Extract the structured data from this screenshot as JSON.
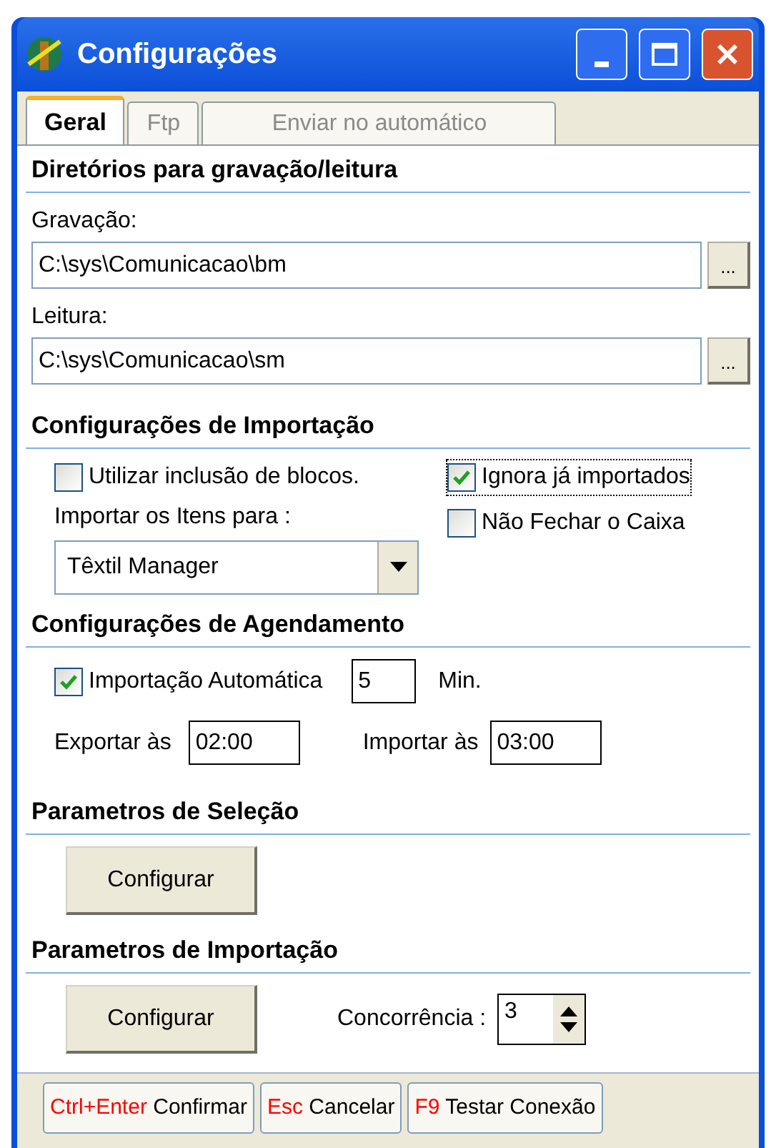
{
  "window": {
    "title": "Configurações"
  },
  "tabs": [
    {
      "label": "Geral",
      "selected": true
    },
    {
      "label": "Ftp",
      "selected": false
    },
    {
      "label": "Enviar no automático",
      "selected": false
    }
  ],
  "directories": {
    "heading": "Diretórios para gravação/leitura",
    "fields": [
      {
        "label": "Gravação:",
        "value": "C:\\sys\\Comunicacao\\bm",
        "button": "..."
      },
      {
        "label": "Leitura:",
        "value": "C:\\sys\\Comunicacao\\sm",
        "button": "..."
      }
    ]
  },
  "import": {
    "heading": "Configurações de Importação",
    "use_blocks": {
      "label": "Utilizar inclusão de blocos.",
      "checked": false
    },
    "ignore_imported": {
      "label": "Ignora já importados",
      "checked": true
    },
    "keep_register_open": {
      "label": "Não Fechar o Caixa",
      "checked": false
    },
    "target_label": "Importar os Itens para :",
    "target_value": "Têxtil Manager"
  },
  "schedule": {
    "heading": "Configurações de Agendamento",
    "auto_import": {
      "label": "Importação Automática",
      "checked": true
    },
    "interval": "5",
    "interval_unit": "Min.",
    "export_label": "Exportar às",
    "export_time": "02:00",
    "import_label": "Importar às",
    "import_time": "03:00"
  },
  "selection_params": {
    "heading": "Parametros de Seleção",
    "button": "Configurar"
  },
  "import_params": {
    "heading": "Parametros de Importação",
    "button": "Configurar",
    "concurrency_label": "Concorrência :",
    "concurrency": "3"
  },
  "footer_buttons": [
    {
      "key": "Ctrl+Enter",
      "label": "Confirmar"
    },
    {
      "key": "Esc",
      "label": "Cancelar"
    },
    {
      "key": "F9",
      "label": "Testar Conexão"
    }
  ]
}
